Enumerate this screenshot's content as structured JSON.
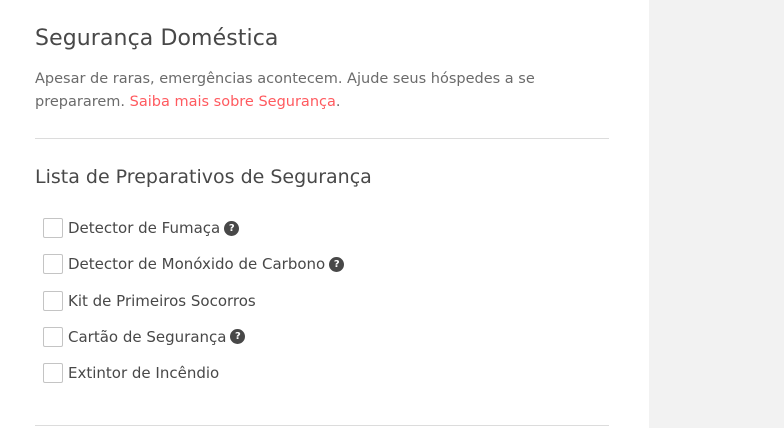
{
  "section": {
    "title": "Segurança Doméstica",
    "description_text": "Apesar de raras, emergências acontecem. Ajude seus hóspedes a se prepararem. ",
    "learn_more_link": "Saiba mais sobre Segurança",
    "trailing_period": "."
  },
  "checklist": {
    "title": "Lista de Preparativos de Segurança",
    "items": [
      {
        "label": "Detector de Fumaça",
        "checked": false,
        "has_help": true
      },
      {
        "label": "Detector de Monóxido de Carbono",
        "checked": false,
        "has_help": true
      },
      {
        "label": "Kit de Primeiros Socorros",
        "checked": false,
        "has_help": false
      },
      {
        "label": "Cartão de Segurança",
        "checked": false,
        "has_help": true
      },
      {
        "label": "Extintor de Incêndio",
        "checked": false,
        "has_help": false
      }
    ],
    "help_icon_glyph": "?"
  },
  "colors": {
    "link": "#ff5a5f",
    "text": "#484848",
    "side_panel": "#f2f2f2"
  },
  "icons": {
    "help": "question-circle-icon"
  }
}
